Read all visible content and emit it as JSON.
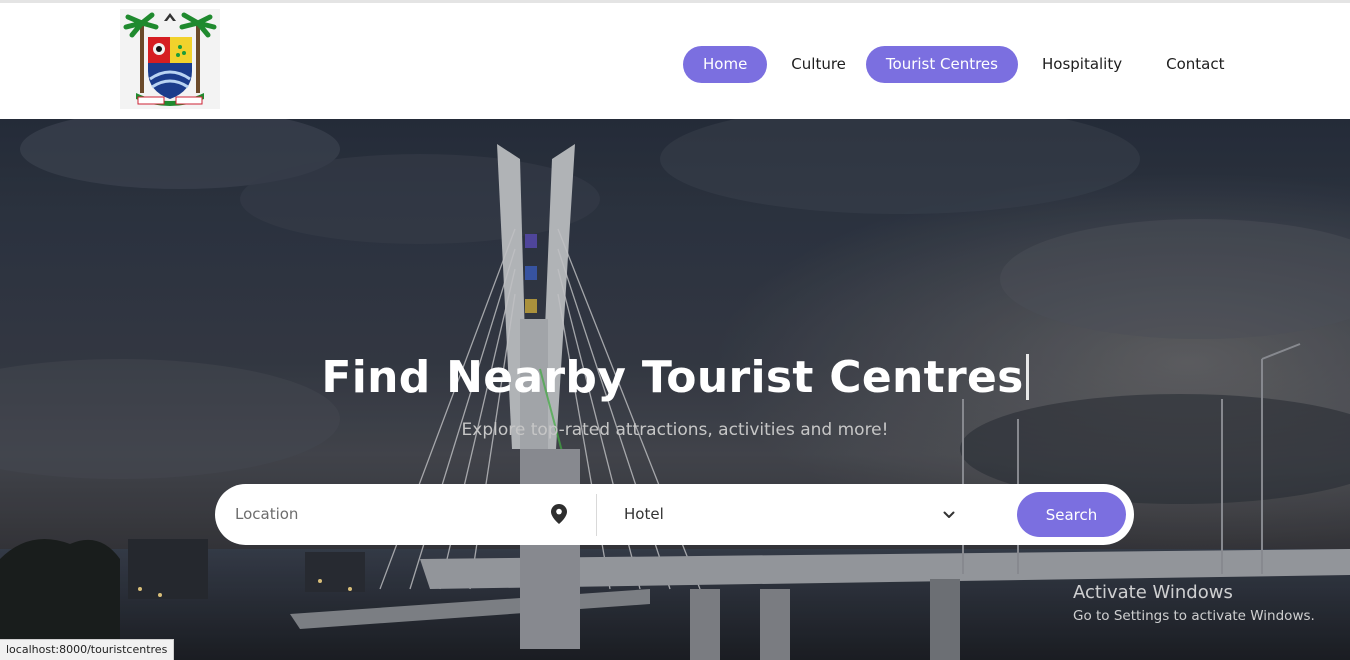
{
  "header": {
    "logo_name": "Lagos State coat of arms",
    "nav": [
      {
        "label": "Home",
        "active": true
      },
      {
        "label": "Culture",
        "active": false
      },
      {
        "label": "Tourist Centres",
        "active": true
      },
      {
        "label": "Hospitality",
        "active": false
      },
      {
        "label": "Contact",
        "active": false
      }
    ]
  },
  "hero": {
    "title": "Find Nearby Tourist Centres",
    "subtitle": "Explore top-rated attractions, activities and more!",
    "background": "Lekki-Ikoyi link bridge at dusk"
  },
  "search": {
    "location_placeholder": "Location",
    "location_icon": "map-pin-icon",
    "type_value": "Hotel",
    "type_icon": "chevron-down-icon",
    "button_label": "Search"
  },
  "watermark": {
    "title": "Activate Windows",
    "subtitle": "Go to Settings to activate Windows."
  },
  "status_bar": {
    "url": "localhost:8000/touristcentres"
  },
  "colors": {
    "accent": "#7b6fe0",
    "header_bg": "#ffffff",
    "text_dark": "#1e1e1e"
  }
}
